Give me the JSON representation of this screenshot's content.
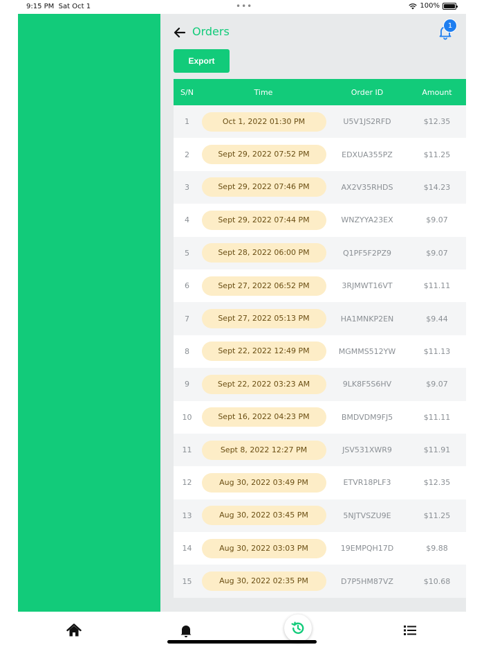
{
  "status_bar": {
    "time": "9:15 PM",
    "date": "Sat Oct 1",
    "battery": "100%"
  },
  "header": {
    "title": "Orders",
    "notification_count": "1"
  },
  "toolbar": {
    "export_label": "Export"
  },
  "table": {
    "columns": [
      "S/N",
      "Time",
      "Order ID",
      "Amount"
    ],
    "rows": [
      {
        "sn": "1",
        "time": "Oct 1, 2022 01:30 PM",
        "order_id": "U5V1JS2RFD",
        "amount": "$12.35"
      },
      {
        "sn": "2",
        "time": "Sept 29, 2022 07:52 PM",
        "order_id": "EDXUA355PZ",
        "amount": "$11.25"
      },
      {
        "sn": "3",
        "time": "Sept 29, 2022 07:46 PM",
        "order_id": "AX2V35RHDS",
        "amount": "$14.23"
      },
      {
        "sn": "4",
        "time": "Sept 29, 2022 07:44 PM",
        "order_id": "WNZYYA23EX",
        "amount": "$9.07"
      },
      {
        "sn": "5",
        "time": "Sept 28, 2022 06:00 PM",
        "order_id": "Q1PF5F2PZ9",
        "amount": "$9.07"
      },
      {
        "sn": "6",
        "time": "Sept 27, 2022 06:52 PM",
        "order_id": "3RJMWT16VT",
        "amount": "$11.11"
      },
      {
        "sn": "7",
        "time": "Sept 27, 2022 05:13 PM",
        "order_id": "HA1MNKP2EN",
        "amount": "$9.44"
      },
      {
        "sn": "8",
        "time": "Sept 22, 2022 12:49 PM",
        "order_id": "MGMMS512YW",
        "amount": "$11.13"
      },
      {
        "sn": "9",
        "time": "Sept 22, 2022 03:23 AM",
        "order_id": "9LK8F5S6HV",
        "amount": "$9.07"
      },
      {
        "sn": "10",
        "time": "Sept 16, 2022 04:23 PM",
        "order_id": "BMDVDM9FJ5",
        "amount": "$11.11"
      },
      {
        "sn": "11",
        "time": "Sept 8, 2022 12:27 PM",
        "order_id": "JSV531XWR9",
        "amount": "$11.91"
      },
      {
        "sn": "12",
        "time": "Aug 30, 2022 03:49 PM",
        "order_id": "ETVR18PLF3",
        "amount": "$12.35"
      },
      {
        "sn": "13",
        "time": "Aug 30, 2022 03:45 PM",
        "order_id": "5NJTVSZU9E",
        "amount": "$11.25"
      },
      {
        "sn": "14",
        "time": "Aug 30, 2022 03:03 PM",
        "order_id": "19EMPQH17D",
        "amount": "$9.88"
      },
      {
        "sn": "15",
        "time": "Aug 30, 2022 02:35 PM",
        "order_id": "D7P5HM87VZ",
        "amount": "$10.68"
      }
    ]
  },
  "tab_bar": {
    "items": [
      {
        "icon": "home-icon",
        "active": false
      },
      {
        "icon": "bell-icon",
        "active": false
      },
      {
        "icon": "history-icon",
        "active": true
      },
      {
        "icon": "list-icon",
        "active": false
      }
    ]
  },
  "colors": {
    "accent": "#12cb7a",
    "pill_bg": "#fdedc7",
    "pill_text": "#6a4e13",
    "badge": "#1e7ef0",
    "content_bg": "#e8eaeb"
  }
}
